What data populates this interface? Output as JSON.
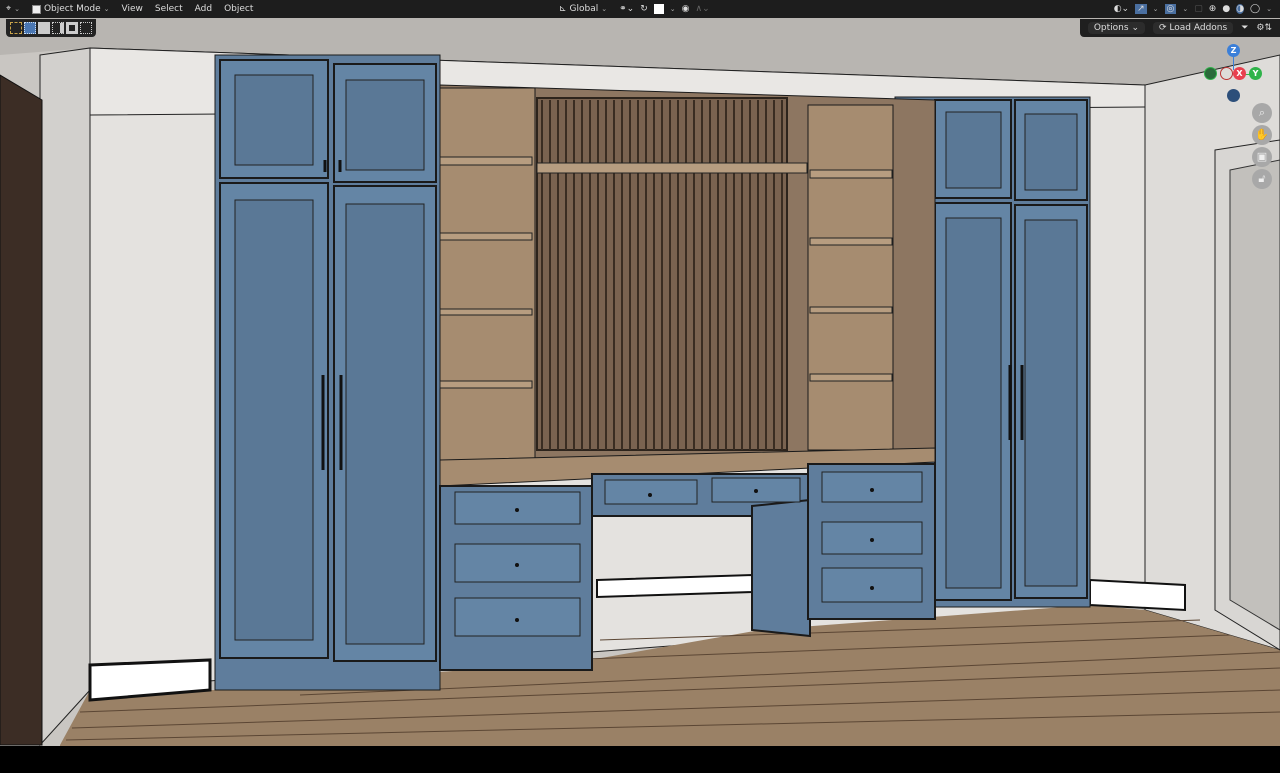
{
  "header": {
    "editor_type_icon": "view3d-icon",
    "mode": "Object Mode",
    "menus": [
      "View",
      "Select",
      "Add",
      "Object"
    ],
    "transform_orientation": "Global",
    "right_icons": [
      "visibility-icon",
      "gizmo-icon",
      "overlay-icon",
      "xray-icon",
      "wireframe-shading-icon",
      "solid-shading-icon",
      "material-shading-icon",
      "rendered-shading-icon"
    ]
  },
  "toolbar": {
    "tools": [
      "select-tool-icon",
      "select-box-icon",
      "mode-extend-icon",
      "mode-subtract-icon",
      "mode-difference-icon",
      "mode-intersect-icon"
    ]
  },
  "options_bar": {
    "options_label": "Options",
    "load_addons_label": "Load Addons"
  },
  "gizmo": {
    "z": "Z",
    "x": "X",
    "y": "Y",
    "colors": {
      "x": "#e8404f",
      "y": "#2fb34a",
      "z": "#3b7fd8"
    }
  },
  "nav_icons": [
    "zoom-icon",
    "pan-hand-icon",
    "camera-icon",
    "lock-icon"
  ],
  "scene_colors": {
    "cabinet": "#5f7d9c",
    "wood": "#a68c70",
    "floor": "#9a8166",
    "wall": "#e4e2df",
    "ceiling": "#b8b5b1"
  }
}
